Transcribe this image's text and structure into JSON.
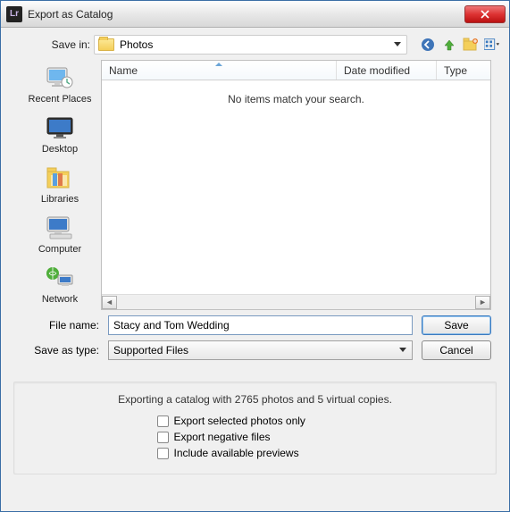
{
  "window": {
    "title": "Export as Catalog"
  },
  "savein": {
    "label": "Save in:",
    "value": "Photos"
  },
  "columns": {
    "name": "Name",
    "date": "Date modified",
    "type": "Type"
  },
  "list": {
    "empty_message": "No items match your search."
  },
  "places": {
    "recent": "Recent Places",
    "desktop": "Desktop",
    "libraries": "Libraries",
    "computer": "Computer",
    "network": "Network"
  },
  "form": {
    "filename_label": "File name:",
    "filename_value": "Stacy and Tom Wedding",
    "savetype_label": "Save as type:",
    "savetype_value": "Supported Files",
    "save_btn": "Save",
    "cancel_btn": "Cancel"
  },
  "export": {
    "summary": "Exporting a catalog with 2765 photos and 5 virtual copies.",
    "opt_selected": "Export selected photos only",
    "opt_negative": "Export negative files",
    "opt_previews": "Include available previews"
  }
}
